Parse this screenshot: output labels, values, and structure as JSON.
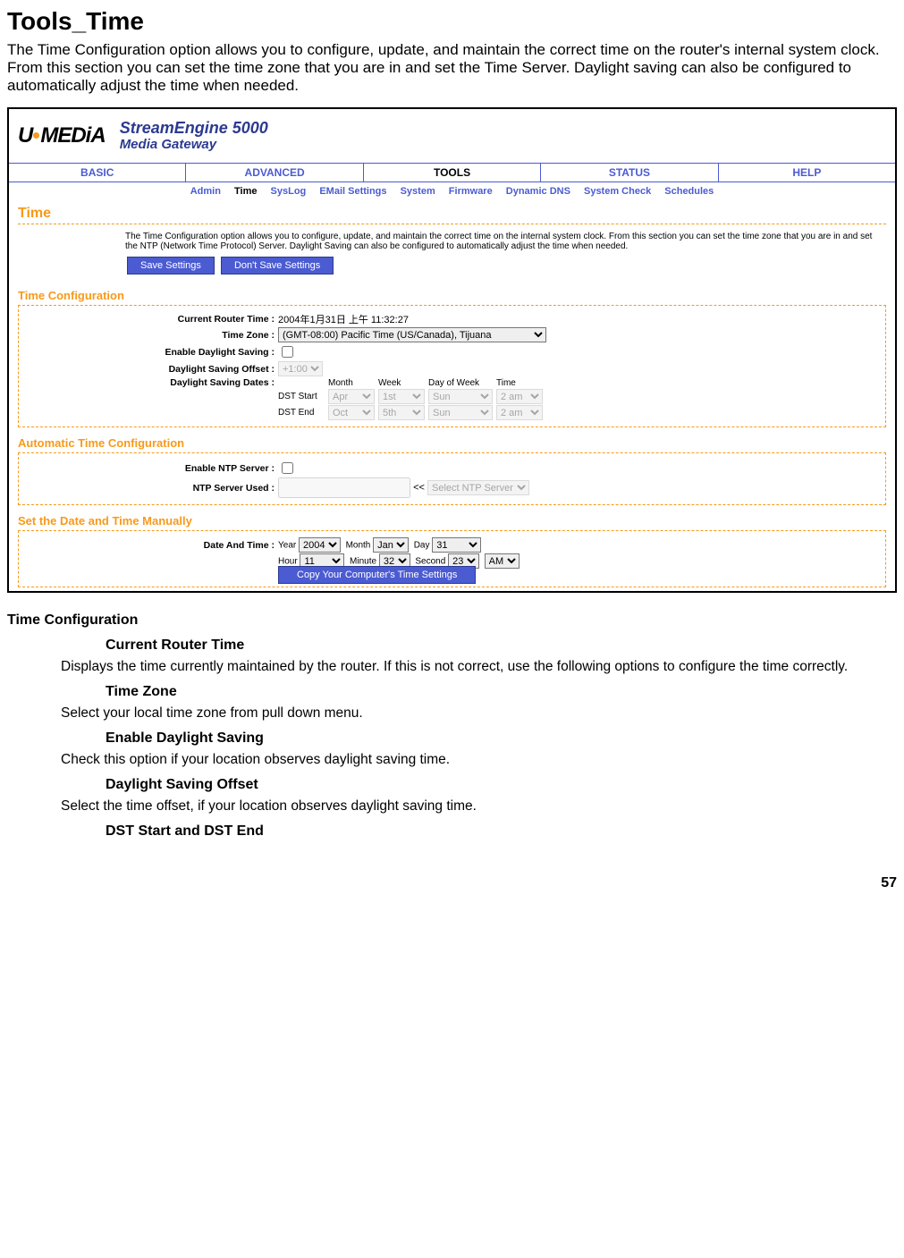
{
  "title": "Tools_Time",
  "intro": "The Time Configuration option allows you to configure, update, and maintain the correct time on the router's internal system clock. From this section you can set the time zone that you are in and set the Time Server. Daylight saving can also be configured to automatically adjust the time when needed.",
  "logo": {
    "brand": "U·MEDIA",
    "line1": "StreamEngine 5000",
    "line2": "Media Gateway"
  },
  "maintabs": [
    "BASIC",
    "ADVANCED",
    "TOOLS",
    "STATUS",
    "HELP"
  ],
  "subtabs": [
    "Admin",
    "Time",
    "SysLog",
    "EMail Settings",
    "System",
    "Firmware",
    "Dynamic DNS",
    "System Check",
    "Schedules"
  ],
  "page_title": "Time",
  "note": "The Time Configuration option allows you to configure, update, and maintain the correct time on the internal system clock. From this section you can set the time zone that you are in and set the NTP (Network Time Protocol) Server. Daylight Saving can also be configured to automatically adjust the time when needed.",
  "buttons": {
    "save": "Save Settings",
    "dont": "Don't Save Settings"
  },
  "tc": {
    "heading": "Time Configuration",
    "labels": {
      "crt": "Current Router Time :",
      "tz": "Time Zone :",
      "eds": "Enable Daylight Saving :",
      "dso": "Daylight Saving Offset :",
      "dsd": "Daylight Saving Dates :"
    },
    "crt_val": "2004年1月31日 上午 11:32:27",
    "tz_val": "(GMT-08:00) Pacific Time (US/Canada), Tijuana",
    "dso_val": "+1:00",
    "headers": {
      "m": "Month",
      "w": "Week",
      "d": "Day of Week",
      "t": "Time"
    },
    "dst_start": {
      "label": "DST Start",
      "m": "Apr",
      "w": "1st",
      "d": "Sun",
      "t": "2 am"
    },
    "dst_end": {
      "label": "DST End",
      "m": "Oct",
      "w": "5th",
      "d": "Sun",
      "t": "2 am"
    }
  },
  "atc": {
    "heading": "Automatic Time Configuration",
    "labels": {
      "en": "Enable NTP Server :",
      "used": "NTP Server Used :"
    },
    "arrow": "<<",
    "sel": "Select NTP Server"
  },
  "man": {
    "heading": "Set the Date and Time Manually",
    "label": "Date And Time :",
    "fields": {
      "yr": "Year",
      "mo": "Month",
      "da": "Day",
      "hr": "Hour",
      "mi": "Minute",
      "se": "Second"
    },
    "vals": {
      "yr": "2004",
      "mo": "Jan",
      "da": "31",
      "hr": "11",
      "mi": "32",
      "se": "23",
      "ap": "AM"
    },
    "copy": "Copy Your Computer's Time Settings"
  },
  "doc": {
    "h2": "Time Configuration",
    "items": [
      {
        "h": "Current Router Time",
        "p": "Displays the time currently maintained by the router. If this is not correct, use the following options to configure the time correctly."
      },
      {
        "h": "Time Zone",
        "p": "Select your local time zone from pull down menu."
      },
      {
        "h": "Enable Daylight Saving",
        "p": "Check this option if your location observes daylight saving time."
      },
      {
        "h": "Daylight Saving Offset",
        "p": "Select the time offset, if your location observes daylight saving time."
      },
      {
        "h": "DST Start and DST End",
        "p": ""
      }
    ]
  },
  "page_num": "57"
}
